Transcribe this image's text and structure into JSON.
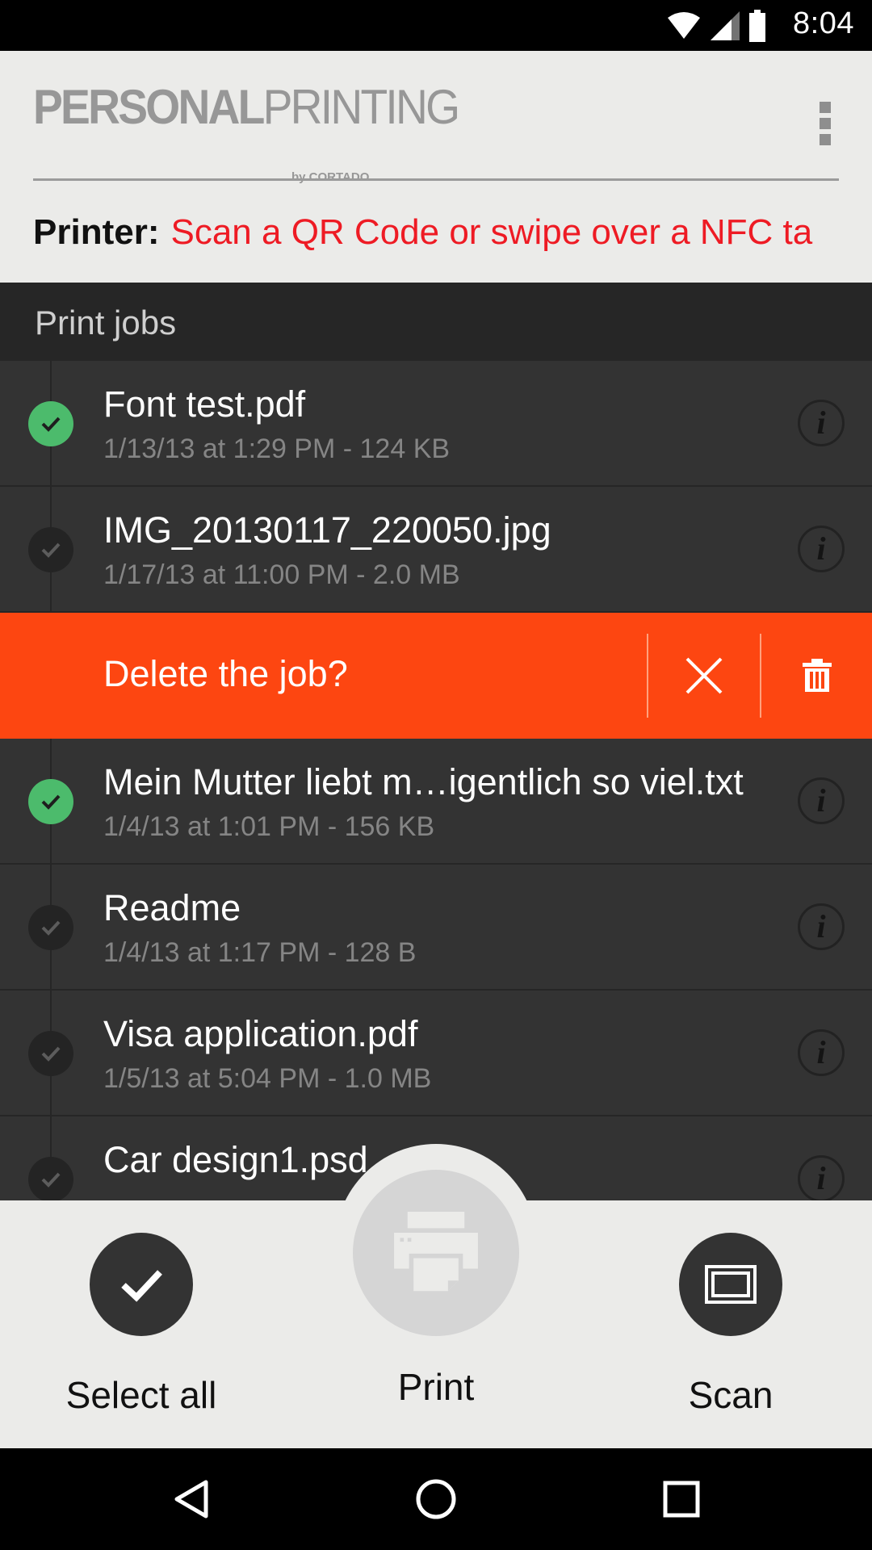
{
  "status_bar": {
    "time": "8:04",
    "icons": [
      "wifi-icon",
      "cell-signal-icon",
      "battery-icon"
    ]
  },
  "header": {
    "logo_main_bold": "PERSONAL",
    "logo_main_light": "PRINTING",
    "logo_sub": "by CORTADO",
    "printer_label": "Printer:",
    "printer_value": "Scan a QR Code or swipe over a NFC ta"
  },
  "section": {
    "title": "Print jobs"
  },
  "jobs": [
    {
      "name": "Font test.pdf",
      "meta": "1/13/13 at 1:29 PM - 124 KB",
      "status": "printed"
    },
    {
      "name": "IMG_20130117_220050.jpg",
      "meta": "1/17/13 at 11:00 PM - 2.0 MB",
      "status": "pending"
    },
    {
      "name": "Mein Mutter liebt m…igentlich so viel.txt",
      "meta": "1/4/13 at 1:01 PM - 156 KB",
      "status": "printed"
    },
    {
      "name": "Readme",
      "meta": "1/4/13 at 1:17 PM - 128 B",
      "status": "pending"
    },
    {
      "name": "Visa application.pdf",
      "meta": "1/5/13 at 5:04 PM - 1.0 MB",
      "status": "pending"
    },
    {
      "name": "Car design1.psd",
      "meta": "",
      "status": "pending"
    }
  ],
  "delete_confirm": {
    "text": "Delete the job?"
  },
  "actions": {
    "select_all": "Select all",
    "print": "Print",
    "scan": "Scan"
  },
  "colors": {
    "accent_red": "#ee1b24",
    "delete_orange": "#fd4611",
    "done_green": "#4cbb6c"
  }
}
